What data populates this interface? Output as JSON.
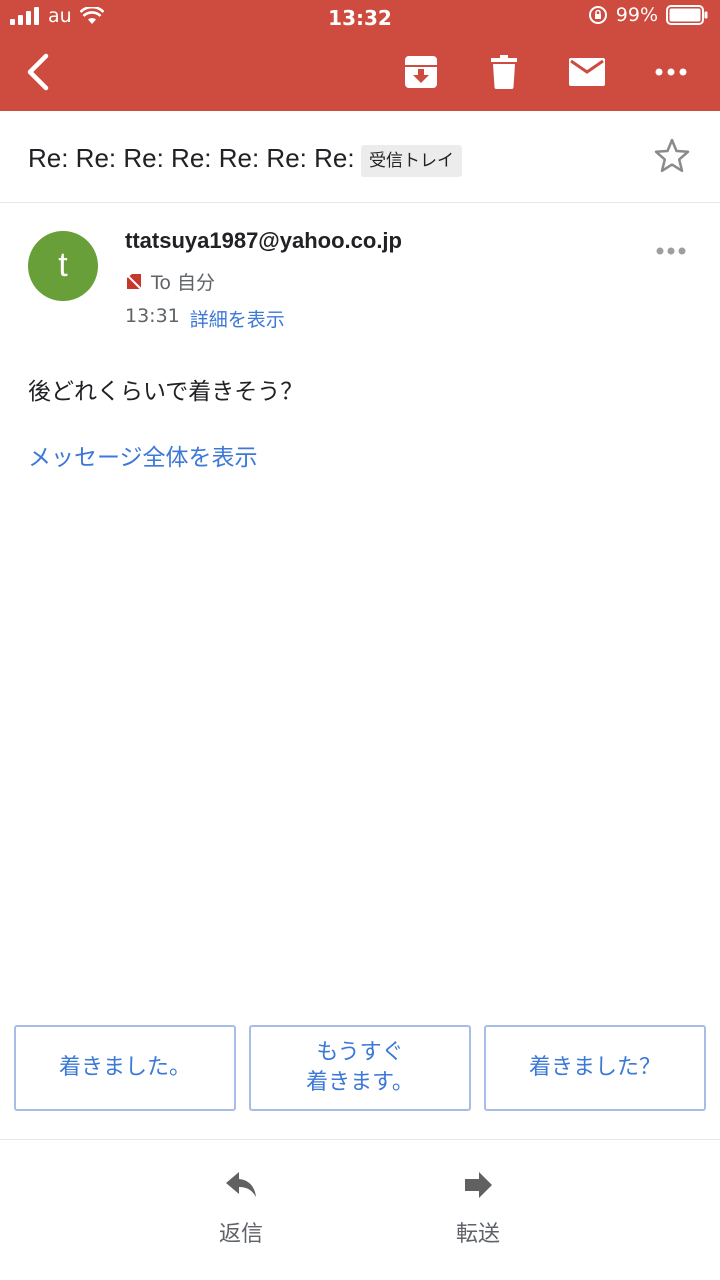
{
  "status_bar": {
    "carrier": "au",
    "time": "13:32",
    "battery": "99%"
  },
  "toolbar": {
    "icons": [
      "back-icon",
      "archive-icon",
      "trash-icon",
      "mail-icon",
      "more-icon"
    ]
  },
  "subject": {
    "text": "Re: Re: Re: Re: Re: Re: Re:",
    "label": "受信トレイ"
  },
  "message": {
    "avatar_letter": "t",
    "avatar_color": "#689f38",
    "sender": "ttatsuya1987@yahoo.co.jp",
    "recipient": "To 自分",
    "time": "13:31",
    "details_link": "詳細を表示",
    "body": "後どれくらいで着きそう？",
    "show_full_link": "メッセージ全体を表示"
  },
  "smart_replies": [
    {
      "line1": "着きました。",
      "line2": ""
    },
    {
      "line1": "もうすぐ",
      "line2": "着きます。"
    },
    {
      "line1": "着きました？",
      "line2": ""
    }
  ],
  "actions": {
    "reply": "返信",
    "forward": "転送"
  },
  "colors": {
    "appbar": "#cd4c3f",
    "link": "#3c78d8"
  }
}
